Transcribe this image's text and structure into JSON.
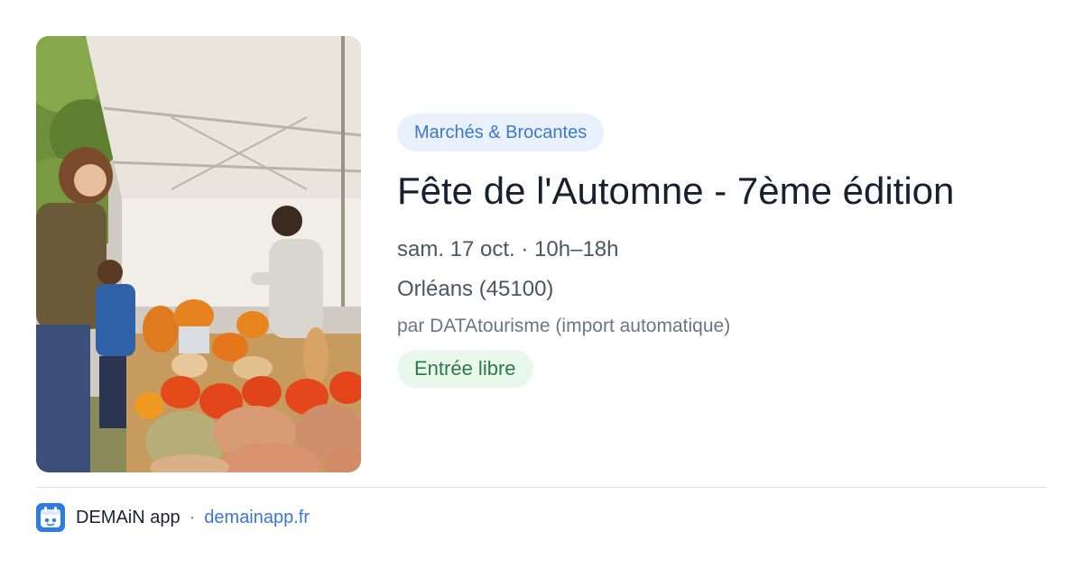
{
  "event": {
    "category": "Marchés & Brocantes",
    "title": "Fête de l'Automne - 7ème édition",
    "date_line": "sam. 17 oct. · 10h–18h",
    "location": "Orléans (45100)",
    "source": "par DATAtourisme (import automatique)",
    "price": "Entrée libre",
    "image_icon": "event-photo-pumpkin-market"
  },
  "footer": {
    "app_name": "DEMAiN app",
    "separator": "·",
    "link": "demainapp.fr",
    "app_icon": "demain-app-logo-icon"
  },
  "colors": {
    "accent_blue": "#3a78d0",
    "category_bg": "#e9f1fd",
    "price_green": "#2c7a45",
    "price_bg": "#eaf7ed",
    "app_icon_bg": "#2f7de1"
  }
}
